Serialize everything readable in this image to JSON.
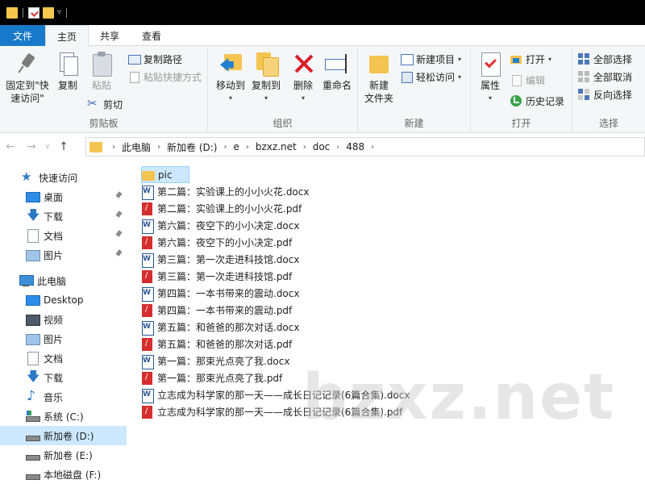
{
  "tabs": {
    "file": "文件",
    "home": "主页",
    "share": "共享",
    "view": "查看"
  },
  "ribbon": {
    "clipboard": {
      "label": "剪贴板",
      "pin_quick_access_line1": "固定到\"快",
      "pin_quick_access_line2": "速访问\"",
      "copy": "复制",
      "paste": "粘贴",
      "copy_path": "复制路径",
      "paste_shortcut": "粘贴快捷方式",
      "cut": "剪切"
    },
    "organize": {
      "label": "组织",
      "move_to": "移动到",
      "copy_to": "复制到",
      "delete": "删除",
      "rename": "重命名"
    },
    "new": {
      "label": "新建",
      "new_folder_line1": "新建",
      "new_folder_line2": "文件夹",
      "new_item": "新建项目",
      "easy_access": "轻松访问"
    },
    "open": {
      "label": "打开",
      "properties": "属性",
      "open": "打开",
      "edit": "编辑",
      "history": "历史记录"
    },
    "select": {
      "label": "选择",
      "select_all": "全部选择",
      "select_none": "全部取消",
      "invert": "反向选择"
    }
  },
  "address": {
    "crumbs": [
      "此电脑",
      "新加卷 (D:)",
      "e",
      "bzxz.net",
      "doc",
      "488"
    ]
  },
  "nav": {
    "quick_access": "快速访问",
    "desktop": "桌面",
    "downloads": "下载",
    "documents": "文档",
    "pictures": "图片",
    "this_pc": "此电脑",
    "pc_desktop": "Desktop",
    "videos": "视频",
    "pc_pictures": "图片",
    "pc_documents": "文档",
    "pc_downloads": "下载",
    "music": "音乐",
    "drive_c": "系统 (C:)",
    "drive_d": "新加卷 (D:)",
    "drive_e": "新加卷 (E:)",
    "drive_f": "本地磁盘 (F:)"
  },
  "files": [
    {
      "name": "pic",
      "type": "folder"
    },
    {
      "name": "第二篇：实验课上的小小火花.docx",
      "type": "word"
    },
    {
      "name": "第二篇：实验课上的小小火花.pdf",
      "type": "pdf"
    },
    {
      "name": "第六篇：夜空下的小小决定.docx",
      "type": "word"
    },
    {
      "name": "第六篇：夜空下的小小决定.pdf",
      "type": "pdf"
    },
    {
      "name": "第三篇：第一次走进科技馆.docx",
      "type": "word"
    },
    {
      "name": "第三篇：第一次走进科技馆.pdf",
      "type": "pdf"
    },
    {
      "name": "第四篇：一本书带来的震动.docx",
      "type": "word"
    },
    {
      "name": "第四篇：一本书带来的震动.pdf",
      "type": "pdf"
    },
    {
      "name": "第五篇：和爸爸的那次对话.docx",
      "type": "word"
    },
    {
      "name": "第五篇：和爸爸的那次对话.pdf",
      "type": "pdf"
    },
    {
      "name": "第一篇：那束光点亮了我.docx",
      "type": "word"
    },
    {
      "name": "第一篇：那束光点亮了我.pdf",
      "type": "pdf"
    },
    {
      "name": "立志成为科学家的那一天——成长日记记录(6篇合集).docx",
      "type": "word"
    },
    {
      "name": "立志成为科学家的那一天——成长日记记录(6篇合集).pdf",
      "type": "pdf"
    }
  ],
  "watermark": "bzxz.net",
  "colors": {
    "file_tab": "#1979ca",
    "selection": "#cce8ff",
    "folder": "#f3c450",
    "delete_red": "#d6202b"
  }
}
